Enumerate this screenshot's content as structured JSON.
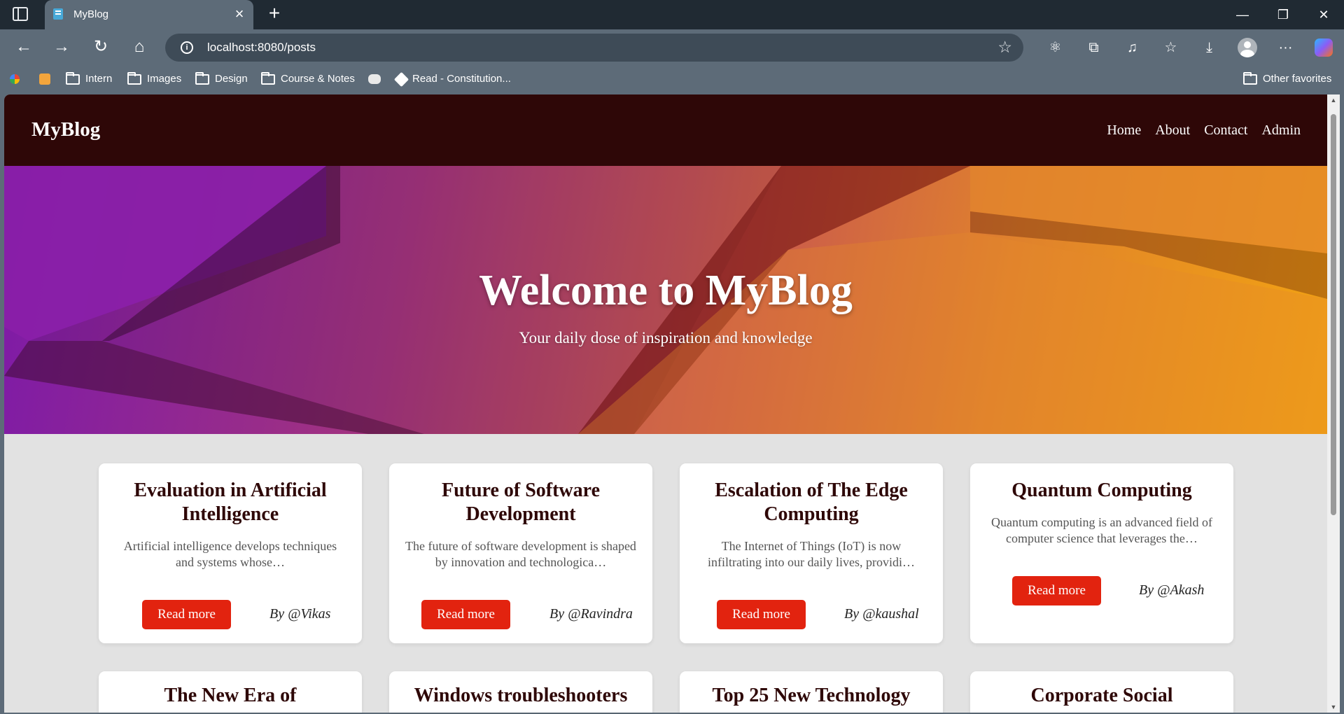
{
  "browser": {
    "tab_title": "MyBlog",
    "url": "localhost:8080/posts",
    "bookmarks": [
      "Intern",
      "Images",
      "Design",
      "Course & Notes",
      "Read - Constitution..."
    ],
    "other_favorites": "Other favorites"
  },
  "site": {
    "brand": "MyBlog",
    "nav": [
      "Home",
      "About",
      "Contact",
      "Admin"
    ]
  },
  "hero": {
    "title": "Welcome to MyBlog",
    "subtitle": "Your daily dose of inspiration and knowledge"
  },
  "posts": [
    {
      "title": "Evaluation in Artificial Intelligence",
      "excerpt": "Artificial intelligence develops techniques and systems whose…",
      "author": "By @Vikas"
    },
    {
      "title": "Future of Software Development",
      "excerpt": "The future of software development is shaped by innovation and technologica…",
      "author": "By @Ravindra"
    },
    {
      "title": "Escalation of The Edge Computing",
      "excerpt": "The Internet of Things (IoT) is now infiltrating into our daily lives, providi…",
      "author": "By @kaushal"
    },
    {
      "title": "Quantum Computing",
      "excerpt": "Quantum computing is an advanced field of computer science that leverages the…",
      "author": "By @Akash"
    },
    {
      "title": "The New Era of",
      "excerpt": "",
      "author": ""
    },
    {
      "title": "Windows troubleshooters",
      "excerpt": "",
      "author": ""
    },
    {
      "title": "Top 25 New Technology",
      "excerpt": "",
      "author": ""
    },
    {
      "title": "Corporate Social",
      "excerpt": "",
      "author": ""
    }
  ],
  "read_more_label": "Read more",
  "colors": {
    "header_bg": "#2e0707",
    "button_bg": "#e2230f",
    "page_bg": "#e2e2e2"
  }
}
